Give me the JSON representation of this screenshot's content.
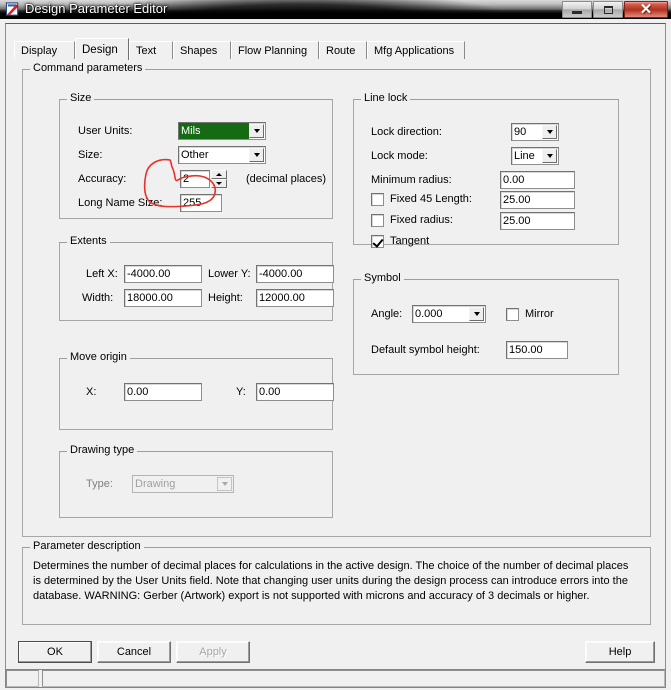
{
  "window": {
    "title": "Design Parameter Editor",
    "icon": "design-editor-icon",
    "minimize_label": "Minimize",
    "maximize_label": "Maximize",
    "close_label": "Close",
    "close_glyph": "✕"
  },
  "tabs": [
    {
      "label": "Display",
      "active": false
    },
    {
      "label": "Design",
      "active": true
    },
    {
      "label": "Text",
      "active": false
    },
    {
      "label": "Shapes",
      "active": false
    },
    {
      "label": "Flow Planning",
      "active": false
    },
    {
      "label": "Route",
      "active": false
    },
    {
      "label": "Mfg Applications",
      "active": false
    }
  ],
  "command_parameters": {
    "legend": "Command parameters",
    "size": {
      "legend": "Size",
      "user_units_label": "User Units:",
      "user_units_value": "Mils",
      "size_label": "Size:",
      "size_value": "Other",
      "accuracy_label": "Accuracy:",
      "accuracy_value": "2",
      "accuracy_suffix": "(decimal places)",
      "long_name_size_label": "Long Name Size:",
      "long_name_size_value": "255",
      "highlight_color": "#146b14"
    },
    "extents": {
      "legend": "Extents",
      "left_x_label": "Left X:",
      "left_x_value": "-4000.00",
      "lower_y_label": "Lower Y:",
      "lower_y_value": "-4000.00",
      "width_label": "Width:",
      "width_value": "18000.00",
      "height_label": "Height:",
      "height_value": "12000.00"
    },
    "move_origin": {
      "legend": "Move origin",
      "x_label": "X:",
      "x_value": "0.00",
      "y_label": "Y:",
      "y_value": "0.00"
    },
    "drawing_type": {
      "legend": "Drawing type",
      "type_label": "Type:",
      "type_value": "Drawing"
    },
    "line_lock": {
      "legend": "Line lock",
      "lock_direction_label": "Lock direction:",
      "lock_direction_value": "90",
      "lock_mode_label": "Lock mode:",
      "lock_mode_value": "Line",
      "minimum_radius_label": "Minimum radius:",
      "minimum_radius_value": "0.00",
      "fixed_45_label": "Fixed 45 Length:",
      "fixed_45_value": "25.00",
      "fixed_radius_label": "Fixed radius:",
      "fixed_radius_value": "25.00",
      "tangent_label": "Tangent"
    },
    "symbol": {
      "legend": "Symbol",
      "angle_label": "Angle:",
      "angle_value": "0.000",
      "mirror_label": "Mirror",
      "default_symbol_height_label": "Default symbol height:",
      "default_symbol_height_value": "150.00"
    }
  },
  "parameter_description": {
    "legend": "Parameter description",
    "text": "Determines the number of decimal places for calculations in the active design. The choice of the number of decimal places is determined by the User Units field. Note that changing user units during the design process can introduce errors into the database. WARNING: Gerber (Artwork) export is not supported with microns and accuracy of 3 decimals or higher."
  },
  "buttons": {
    "ok": "OK",
    "cancel": "Cancel",
    "apply": "Apply",
    "help": "Help"
  },
  "statusbar": {
    "pane1": "",
    "pane2": ""
  },
  "annotation": {
    "color": "#e8312a",
    "shape": "hand-drawn-circle-around-long-name-size"
  }
}
